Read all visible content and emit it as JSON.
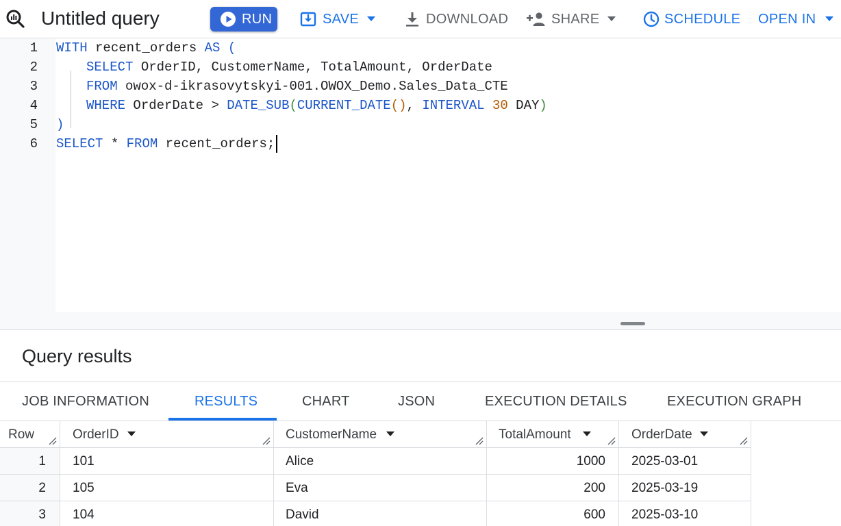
{
  "toolbar": {
    "title": "Untitled query",
    "run_label": "RUN",
    "save_label": "SAVE",
    "download_label": "DOWNLOAD",
    "share_label": "SHARE",
    "schedule_label": "SCHEDULE",
    "open_in_label": "OPEN IN",
    "icons": {
      "app": "query-magnifier-icon",
      "run": "play-circle-icon",
      "save": "save-icon",
      "download": "download-icon",
      "share": "person-add-icon",
      "schedule": "clock-icon",
      "caret": "caret-down-icon"
    }
  },
  "editor": {
    "line_numbers": [
      "1",
      "2",
      "3",
      "4",
      "5",
      "6"
    ],
    "code": [
      "WITH recent_orders AS (",
      "    SELECT OrderID, CustomerName, TotalAmount, OrderDate",
      "    FROM owox-d-ikrasovytskyi-001.OWOX_Demo.Sales_Data_CTE",
      "    WHERE OrderDate > DATE_SUB(CURRENT_DATE(), INTERVAL 30 DAY)",
      ")",
      "SELECT * FROM recent_orders;"
    ],
    "tokens": {
      "with": "WITH",
      "cte_name": "recent_orders",
      "as": "AS",
      "open_paren": "(",
      "select": "SELECT",
      "select_cols": "OrderID, CustomerName, TotalAmount, OrderDate",
      "from": "FROM",
      "table": "owox-d-ikrasovytskyi-001.OWOX_Demo.Sales_Data_CTE",
      "where": "WHERE",
      "where_lhs": "OrderDate >",
      "date_sub": "DATE_SUB",
      "current_date": "CURRENT_DATE",
      "empty_parens": "()",
      "comma": ",",
      "interval": "INTERVAL",
      "interval_value": "30",
      "day": "DAY",
      "close_paren": ")",
      "star": "*",
      "semicolon": ";"
    }
  },
  "results": {
    "title": "Query results",
    "tabs": [
      "JOB INFORMATION",
      "RESULTS",
      "CHART",
      "JSON",
      "EXECUTION DETAILS",
      "EXECUTION GRAPH"
    ],
    "active_tab": "RESULTS",
    "columns": [
      "Row",
      "OrderID",
      "CustomerName",
      "TotalAmount",
      "OrderDate"
    ],
    "rows": [
      {
        "row": "1",
        "OrderID": "101",
        "CustomerName": "Alice",
        "TotalAmount": "1000",
        "OrderDate": "2025-03-01"
      },
      {
        "row": "2",
        "OrderID": "105",
        "CustomerName": "Eva",
        "TotalAmount": "200",
        "OrderDate": "2025-03-19"
      },
      {
        "row": "3",
        "OrderID": "104",
        "CustomerName": "David",
        "TotalAmount": "600",
        "OrderDate": "2025-03-10"
      }
    ]
  },
  "colors": {
    "primary": "#1a73e8",
    "run_button": "#3367d6",
    "keyword": "#1a56c8",
    "number": "#b55a00",
    "paren": "#3d8b3d"
  }
}
